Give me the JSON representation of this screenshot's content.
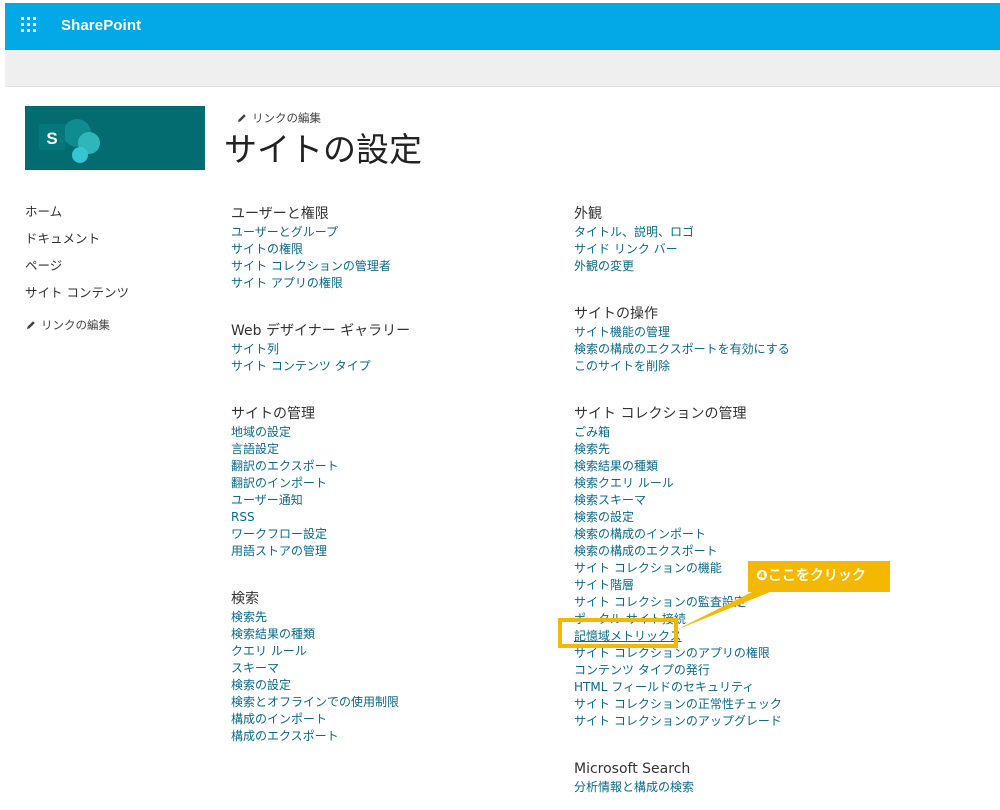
{
  "suite": {
    "app_name": "SharePoint",
    "waffle_icon": "waffle-icon",
    "bar_color": "#03a9e6"
  },
  "logo": {
    "letter": "S",
    "bg": "#036c70"
  },
  "header": {
    "edit_links": "リンクの編集",
    "title": "サイトの設定"
  },
  "leftnav": {
    "items": [
      "ホーム",
      "ドキュメント",
      "ページ",
      "サイト コンテンツ"
    ],
    "edit_links": "リンクの編集"
  },
  "columns": {
    "left": [
      {
        "title": "ユーザーと権限",
        "links": [
          "ユーザーとグループ",
          "サイトの権限",
          "サイト コレクションの管理者",
          "サイト アプリの権限"
        ]
      },
      {
        "title": "Web デザイナー ギャラリー",
        "links": [
          "サイト列",
          "サイト コンテンツ タイプ"
        ]
      },
      {
        "title": "サイトの管理",
        "links": [
          "地域の設定",
          "言語設定",
          "翻訳のエクスポート",
          "翻訳のインポート",
          "ユーザー通知",
          "RSS",
          "ワークフロー設定",
          "用語ストアの管理"
        ]
      },
      {
        "title": "検索",
        "links": [
          "検索先",
          "検索結果の種類",
          "クエリ ルール",
          "スキーマ",
          "検索の設定",
          "検索とオフラインでの使用制限",
          "構成のインポート",
          "構成のエクスポート"
        ]
      }
    ],
    "right": [
      {
        "title": "外観",
        "links": [
          "タイトル、説明、ロゴ",
          "サイド リンク バー",
          "外観の変更"
        ]
      },
      {
        "title": "サイトの操作",
        "links": [
          "サイト機能の管理",
          "検索の構成のエクスポートを有効にする",
          "このサイトを削除"
        ]
      },
      {
        "title": "サイト コレクションの管理",
        "links": [
          "ごみ箱",
          "検索先",
          "検索結果の種類",
          "検索クエリ ルール",
          "検索スキーマ",
          "検索の設定",
          "検索の構成のインポート",
          "検索の構成のエクスポート",
          "サイト コレクションの機能",
          "サイト階層",
          "サイト コレクションの監査設定",
          "ポータル サイト接続",
          "記憶域メトリックス",
          "サイト コレクションのアプリの権限",
          "コンテンツ タイプの発行",
          "HTML フィールドのセキュリティ",
          "サイト コレクションの正常性チェック",
          "サイト コレクションのアップグレード"
        ]
      },
      {
        "title": "Microsoft Search",
        "links": [
          "分析情報と構成の検索"
        ]
      }
    ]
  },
  "annotation": {
    "number": "❹",
    "text": "ここをクリック",
    "color": "#f5b800"
  }
}
